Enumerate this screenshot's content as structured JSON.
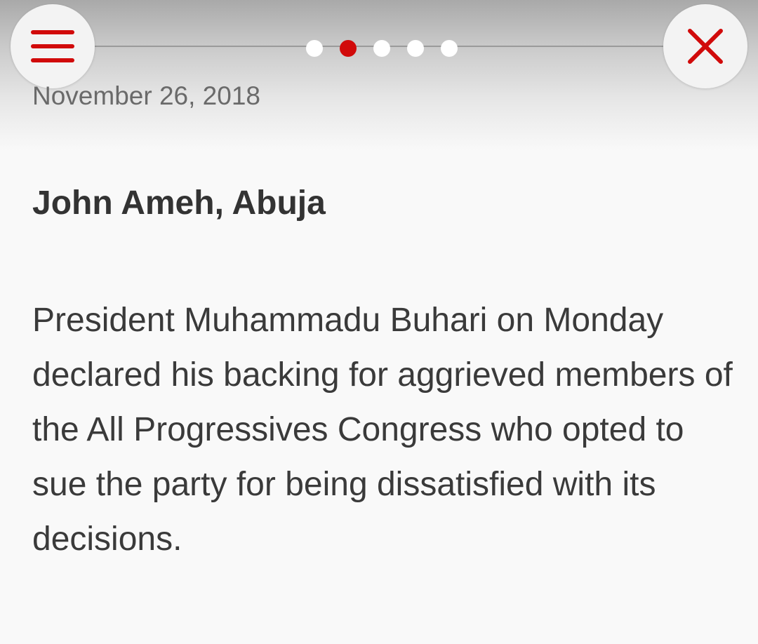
{
  "nav": {
    "menu_icon": "hamburger-menu-icon",
    "close_icon": "close-x-icon",
    "pages": 5,
    "active_page": 2
  },
  "colors": {
    "accent": "#d10a0a",
    "background": "#f9f9f9",
    "text": "#333333",
    "muted": "#6a6a6a"
  },
  "article": {
    "date": "November 26, 2018",
    "byline": "John Ameh, Abuja",
    "paragraph": "President Muhammadu Buhari on Monday declared his backing for aggrieved members of the All Progressives Congress who opted to sue the party for being dissatisfied with its decisions."
  }
}
